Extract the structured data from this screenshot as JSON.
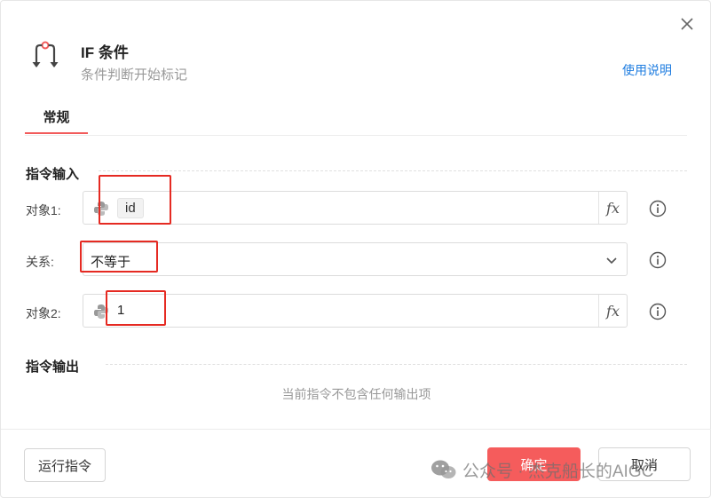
{
  "dialog": {
    "title": "IF 条件",
    "subtitle": "条件判断开始标记",
    "help_link": "使用说明",
    "close_icon": "close-icon",
    "header_icon": "if-branch-icon"
  },
  "tabs": [
    {
      "label": "常规",
      "active": true
    }
  ],
  "input_section": {
    "title": "指令输入",
    "object1": {
      "label": "对象1:",
      "value": "id",
      "icon": "python-icon",
      "fx": "fx"
    },
    "relation": {
      "label": "关系:",
      "value": "不等于",
      "icon": "chevron-down-icon"
    },
    "object2": {
      "label": "对象2:",
      "value": "1",
      "icon": "python-icon",
      "fx": "fx"
    },
    "info_icon": "info-icon"
  },
  "output_section": {
    "title": "指令输出",
    "empty_text": "当前指令不包含任何输出项"
  },
  "footer": {
    "run_label": "运行指令",
    "ok_label": "确定",
    "cancel_label": "取消"
  },
  "watermark": {
    "icon": "wechat-icon",
    "text": "公众号 · 杰克船长的AIGC"
  },
  "colors": {
    "accent": "#f25b5b",
    "primary_button": "#f55c5c",
    "link": "#1f7de0",
    "highlight_box": "#e52a22"
  }
}
